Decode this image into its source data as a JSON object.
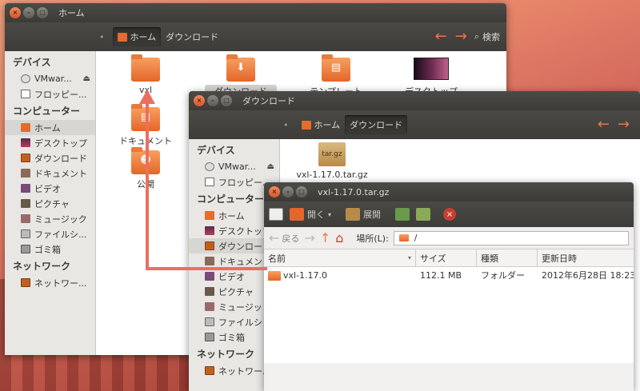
{
  "win_home": {
    "title": "ホーム",
    "crumb": "ホーム",
    "crumb2": "ダウンロード",
    "search": "検索",
    "sidebar": {
      "devices": "デバイス",
      "vmware": "VMwar...",
      "floppy": "フロッピー...",
      "computer": "コンピューター",
      "home": "ホーム",
      "desktop": "デスクトップ",
      "downloads": "ダウンロード",
      "documents": "ドキュメント",
      "videos": "ビデオ",
      "pictures": "ピクチャ",
      "music": "ミュージック",
      "filesystem": "ファイルシ...",
      "trash": "ゴミ箱",
      "network": "ネットワーク",
      "netitem": "ネットワー..."
    },
    "icons": {
      "vxl": "vxl",
      "downloads": "ダウンロード",
      "templates": "テンプレート",
      "desktop": "デスクトップ",
      "documents": "ドキュメント",
      "public": "公開"
    }
  },
  "win_dl": {
    "title": "ダウンロード",
    "crumb": "ホーム",
    "crumb2": "ダウンロード",
    "sidebar": {
      "devices": "デバイス",
      "vmware": "VMwar...",
      "floppy": "フロッピー...",
      "computer": "コンピューター",
      "home": "ホーム",
      "desktop": "デスクトップ",
      "downloads": "ダウンロー",
      "documents": "ドキュメン",
      "videos": "ビデオ",
      "pictures": "ピクチャ",
      "music": "ミュージッ",
      "filesystem": "ファイルシ",
      "trash": "ゴミ箱",
      "network": "ネットワーク",
      "netitem": "ネットワー..."
    },
    "file": "vxl-1.17.0.tar.gz",
    "box_label": "tar.gz"
  },
  "win_ar": {
    "title": "vxl-1.17.0.tar.gz",
    "open": "開く",
    "extract": "展開",
    "back": "戻る",
    "location_label": "場所(L):",
    "location": "/",
    "columns": {
      "name": "名前",
      "size": "サイズ",
      "type": "種類",
      "modified": "更新日時"
    },
    "rows": [
      {
        "name": "vxl-1.17.0",
        "size": "112.1 MB",
        "type": "フォルダー",
        "modified": "2012年6月28日 18:23"
      }
    ]
  },
  "colors": {
    "accent": "#f07746",
    "arrow": "#ee6e5e"
  }
}
